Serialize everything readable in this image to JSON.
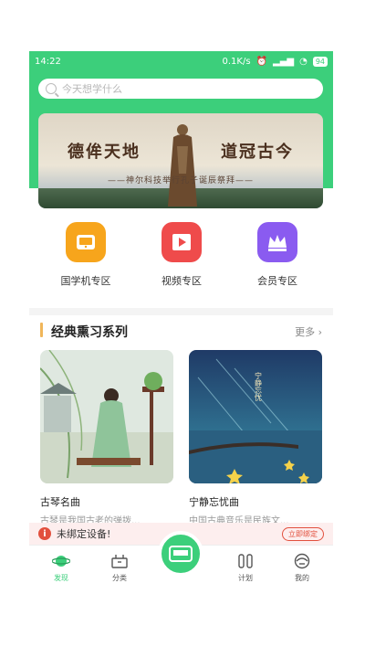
{
  "status_bar": {
    "time": "14:22",
    "net": "0.1K/s",
    "battery": "94"
  },
  "search": {
    "placeholder": "今天想学什么"
  },
  "banner": {
    "title_left": "德侔天地",
    "title_right": "道冠古今",
    "subtitle": "——神尔科技举行孔子诞辰祭拜——"
  },
  "categories": [
    {
      "label": "国学机专区",
      "color": "#f7a51c",
      "icon": "device-icon"
    },
    {
      "label": "视频专区",
      "color": "#ef4b4b",
      "icon": "video-icon"
    },
    {
      "label": "会员专区",
      "color": "#8a5bf0",
      "icon": "crown-icon"
    }
  ],
  "section": {
    "title": "经典熏习系列",
    "more": "更多"
  },
  "cards": [
    {
      "title": "古琴名曲",
      "desc": "古琴是我国古老的弹拨..."
    },
    {
      "title": "宁静忘忧曲",
      "desc": "中国古典音乐是民族文..."
    }
  ],
  "notice": {
    "text": "未绑定设备!",
    "button": "立即绑定"
  },
  "tabs": [
    {
      "label": "发现",
      "icon": "planet-icon",
      "active": true
    },
    {
      "label": "分类",
      "icon": "category-icon",
      "active": false
    },
    {
      "label": "计划",
      "icon": "plan-icon",
      "active": false
    },
    {
      "label": "我的",
      "icon": "profile-icon",
      "active": false
    }
  ],
  "colors": {
    "brand_green": "#3ccf7b",
    "accent_orange": "#f0b65a",
    "alert_red": "#e2503e"
  }
}
